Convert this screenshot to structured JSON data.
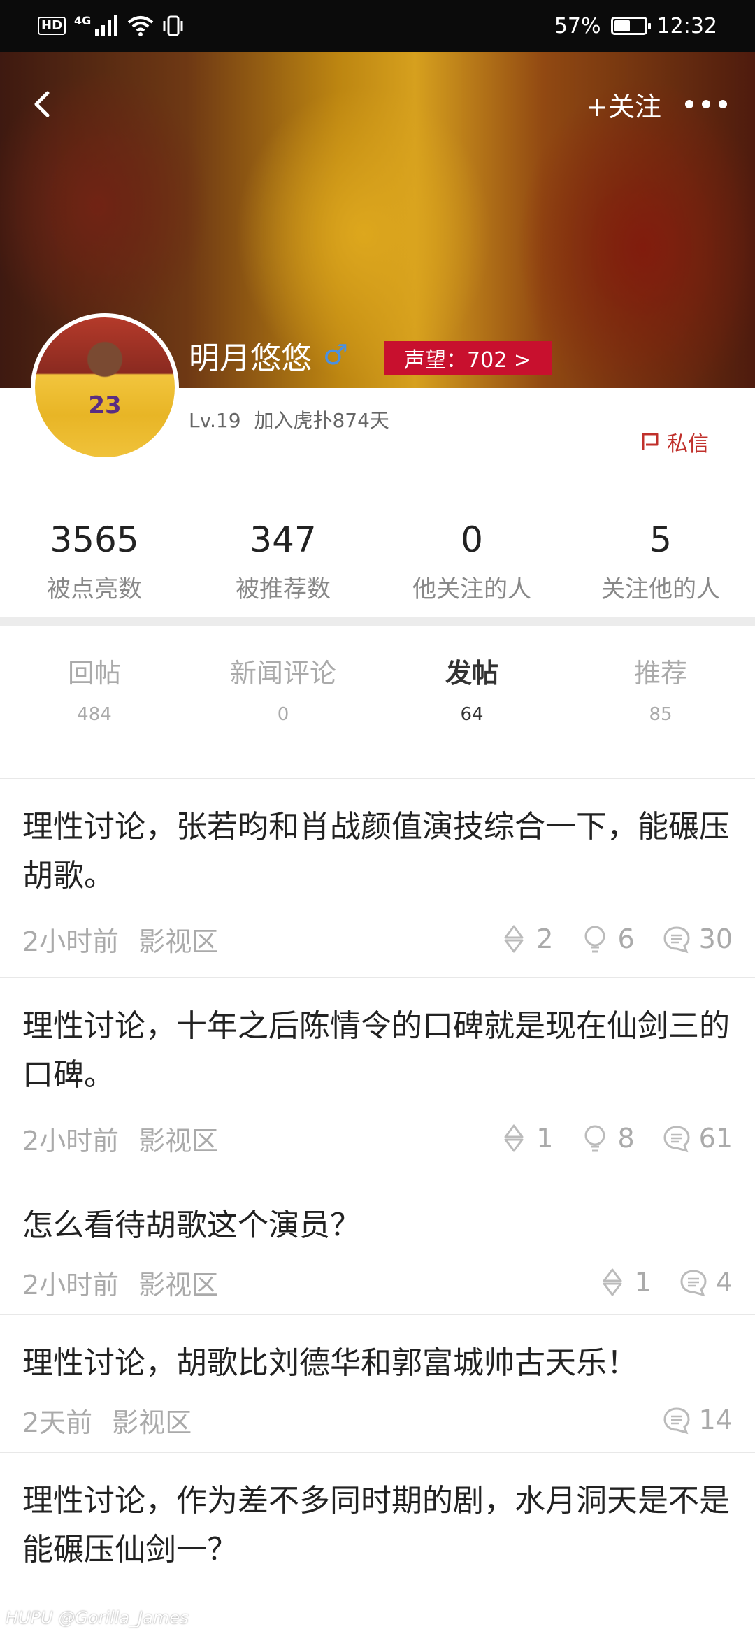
{
  "status_bar": {
    "left_badges": [
      "HD",
      "4G"
    ],
    "battery": "57%",
    "battery_level": 0.57,
    "time": "12:32"
  },
  "header": {
    "follow_label": "+关注"
  },
  "profile": {
    "avatar_jersey_number": "23",
    "name": "明月悠悠",
    "gender_symbol": "♂",
    "reputation": "声望：702 >",
    "level": "Lv.19",
    "joined": "加入虎扑874天",
    "dm_label": "私信"
  },
  "stats": [
    {
      "value": "3565",
      "label": "被点亮数"
    },
    {
      "value": "347",
      "label": "被推荐数"
    },
    {
      "value": "0",
      "label": "他关注的人"
    },
    {
      "value": "5",
      "label": "关注他的人"
    }
  ],
  "tabs": [
    {
      "label": "回帖",
      "count": "484"
    },
    {
      "label": "新闻评论",
      "count": "0"
    },
    {
      "label": "发帖",
      "count": "64"
    },
    {
      "label": "推荐",
      "count": "85"
    }
  ],
  "active_tab": "发帖",
  "posts": [
    {
      "title": "理性讨论，张若昀和肖战颜值演技综合一下，能碾压胡歌。",
      "time": "2小时前",
      "board": "影视区",
      "recommend": "2",
      "lights": "6",
      "replies": "30"
    },
    {
      "title": "理性讨论，十年之后陈情令的口碑就是现在仙剑三的口碑。",
      "time": "2小时前",
      "board": "影视区",
      "recommend": "1",
      "lights": "8",
      "replies": "61"
    },
    {
      "title": "怎么看待胡歌这个演员？",
      "time": "2小时前",
      "board": "影视区",
      "recommend": "1",
      "replies": "4"
    },
    {
      "title": "理性讨论，胡歌比刘德华和郭富城帅古天乐！",
      "time": "2天前",
      "board": "影视区",
      "replies": "14"
    },
    {
      "title": "理性讨论，作为差不多同时期的剧，水月洞天是不是能碾压仙剑一？"
    }
  ],
  "watermark": "HUPU @Gorilla_James",
  "colors": {
    "accent_red": "#c8102e",
    "gender_blue": "#4a90e2"
  }
}
